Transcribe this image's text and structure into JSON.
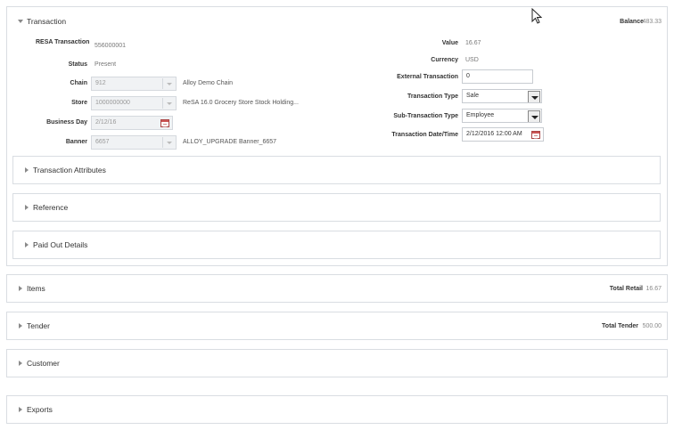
{
  "transaction": {
    "title": "Transaction",
    "balance_label": "Balance",
    "balance_value": "483.33",
    "fields": {
      "resa_label": "RESA Transaction",
      "resa_value": "556000001",
      "status_label": "Status",
      "status_value": "Present",
      "chain_label": "Chain",
      "chain_value": "912",
      "chain_desc": "Alloy Demo Chain",
      "store_label": "Store",
      "store_value": "1000000000",
      "store_desc": "ReSA 16.0 Grocery Store Stock Holding...",
      "business_day_label": "Business Day",
      "business_day_value": "2/12/16",
      "banner_label": "Banner",
      "banner_value": "6657",
      "banner_desc": "ALLOY_UPGRADE Banner_6657",
      "value_label": "Value",
      "value_value": "16.67",
      "currency_label": "Currency",
      "currency_value": "USD",
      "external_label": "External Transaction",
      "external_value": "0",
      "type_label": "Transaction Type",
      "type_value": "Sale",
      "subtype_label": "Sub-Transaction Type",
      "subtype_value": "Employee",
      "datetime_label": "Transaction Date/Time",
      "datetime_value": "2/12/2016 12:00 AM"
    },
    "subpanels": {
      "attributes": "Transaction Attributes",
      "reference": "Reference",
      "paid_out": "Paid Out Details"
    }
  },
  "items": {
    "title": "Items",
    "total_label": "Total Retail",
    "total_value": "16.67"
  },
  "tender": {
    "title": "Tender",
    "total_label": "Total Tender",
    "total_value": "500.00"
  },
  "customer": {
    "title": "Customer"
  },
  "exports": {
    "title": "Exports"
  }
}
